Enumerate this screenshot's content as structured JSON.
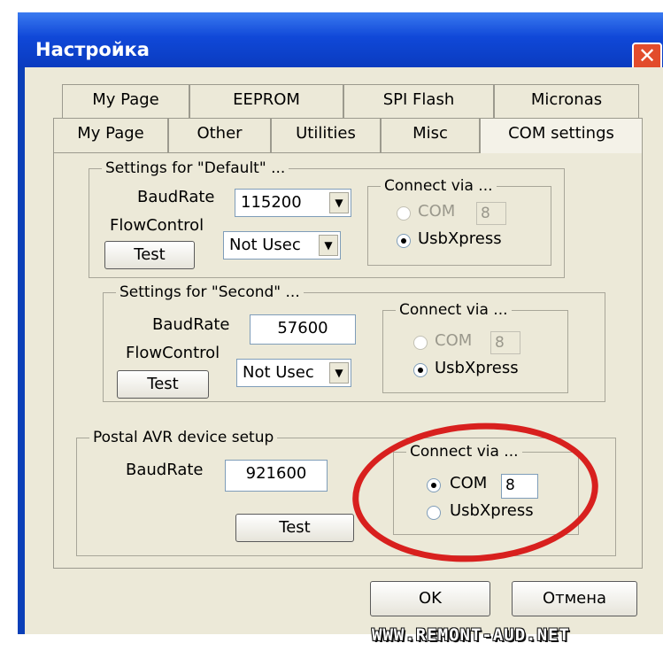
{
  "window": {
    "title": "Настройка"
  },
  "tabs": {
    "row1": [
      "My Page",
      "EEPROM",
      "SPI Flash",
      "Micronas"
    ],
    "row2": [
      "My Page",
      "Other",
      "Utilities",
      "Misc",
      "COM settings"
    ],
    "active": "COM settings"
  },
  "default_group": {
    "legend": "Settings for \"Default\" ...",
    "baud_label": "BaudRate",
    "baud_value": "115200",
    "flow_label": "FlowControl",
    "flow_value": "Not Usec",
    "test_label": "Test",
    "connect_legend": "Connect via ...",
    "com_label": "COM",
    "com_port": "8",
    "usb_label": "UsbXpress",
    "selected": "UsbXpress"
  },
  "second_group": {
    "legend": "Settings for \"Second\" ...",
    "baud_label": "BaudRate",
    "baud_value": "57600",
    "flow_label": "FlowControl",
    "flow_value": "Not Usec",
    "test_label": "Test",
    "connect_legend": "Connect via ...",
    "com_label": "COM",
    "com_port": "8",
    "usb_label": "UsbXpress",
    "selected": "UsbXpress"
  },
  "postal_group": {
    "legend": "Postal AVR device setup",
    "baud_label": "BaudRate",
    "baud_value": "921600",
    "test_label": "Test",
    "connect_legend": "Connect via ...",
    "com_label": "COM",
    "com_port": "8",
    "usb_label": "UsbXpress",
    "selected": "COM"
  },
  "buttons": {
    "ok": "OK",
    "cancel": "Отмена"
  },
  "watermark": "WWW.REMONT-AUD.NET",
  "colors": {
    "titlebar": "#1048d8",
    "face": "#ece9d8",
    "highlight_ellipse": "#d8201e",
    "close": "#e24c2c"
  }
}
